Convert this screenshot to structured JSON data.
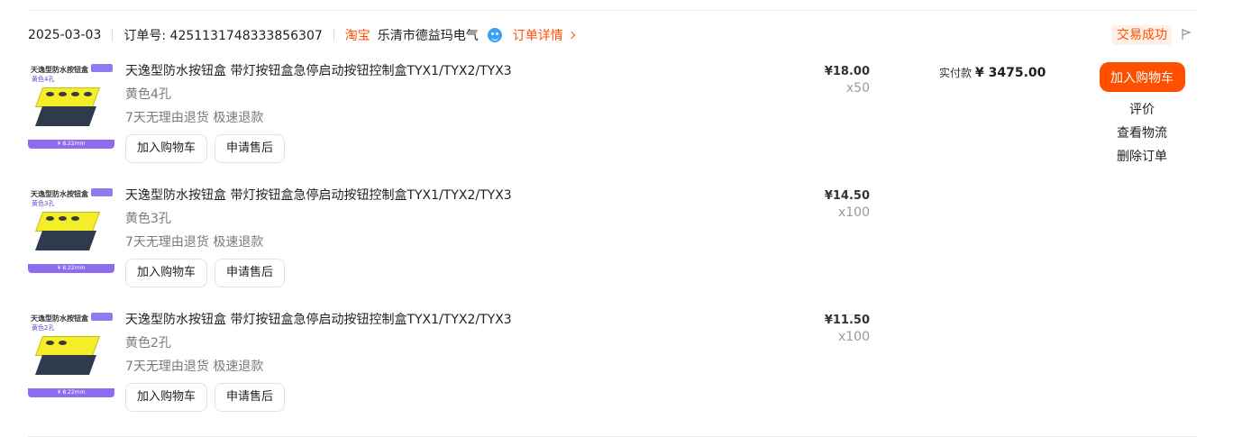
{
  "header": {
    "date": "2025-03-03",
    "order_label": "订单号: 4251131748333856307",
    "platform": "淘宝",
    "shop": "乐清市德益玛电气",
    "detail_link": "订单详情",
    "status": "交易成功"
  },
  "items": [
    {
      "title": "天逸型防水按钮盒 带灯按钮盒急停启动按钮控制盒TYX1/TYX2/TYX3",
      "spec": "黄色4孔",
      "service": "7天无理由退货 极速退款",
      "price": "¥18.00",
      "qty": "x50",
      "btn_cart": "加入购物车",
      "btn_after": "申请售后",
      "thumb_title": "天逸型防水按钮盒",
      "thumb_spec": "黄色4孔",
      "thumb_bar": "¥ 8.22mm",
      "holes": 4
    },
    {
      "title": "天逸型防水按钮盒 带灯按钮盒急停启动按钮控制盒TYX1/TYX2/TYX3",
      "spec": "黄色3孔",
      "service": "7天无理由退货 极速退款",
      "price": "¥14.50",
      "qty": "x100",
      "btn_cart": "加入购物车",
      "btn_after": "申请售后",
      "thumb_title": "天逸型防水按钮盒",
      "thumb_spec": "黄色3孔",
      "thumb_bar": "¥ 8.22mm",
      "holes": 3
    },
    {
      "title": "天逸型防水按钮盒 带灯按钮盒急停启动按钮控制盒TYX1/TYX2/TYX3",
      "spec": "黄色2孔",
      "service": "7天无理由退货 极速退款",
      "price": "¥11.50",
      "qty": "x100",
      "btn_cart": "加入购物车",
      "btn_after": "申请售后",
      "thumb_title": "天逸型防水按钮盒",
      "thumb_spec": "黄色2孔",
      "thumb_bar": "¥ 8.22mm",
      "holes": 2
    }
  ],
  "payment": {
    "label": "实付款",
    "amount": "¥ 3475.00"
  },
  "actions": {
    "primary": "加入购物车",
    "review": "评价",
    "logistics": "查看物流",
    "delete": "删除订单"
  },
  "colors": {
    "accent": "#ff5000",
    "ww_icon": "#3aa0f5"
  },
  "icons": [
    "wangwang-icon",
    "chevron-right-icon",
    "flag-icon"
  ]
}
